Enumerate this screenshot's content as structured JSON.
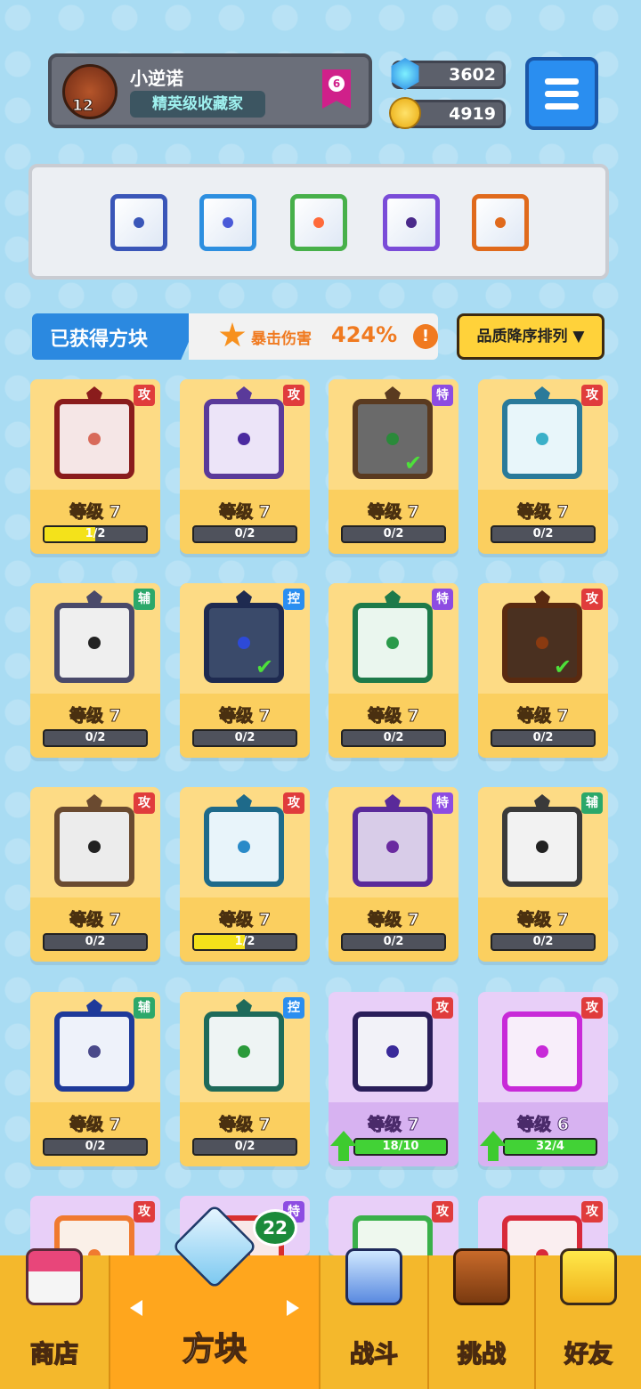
{
  "profile": {
    "name": "小逆诺",
    "title": "精英级收藏家",
    "level": "12",
    "rank_badge": "6"
  },
  "resources": {
    "gems": "3602",
    "coins": "4919"
  },
  "equipped": [
    {
      "icon": "gear-dice",
      "color": "#3a56b8",
      "dot": "#3a56b8"
    },
    {
      "icon": "snowflake-dice",
      "color": "#2d8fe0",
      "dot": "#4a5ad8"
    },
    {
      "icon": "infinity-dice",
      "color": "#47b04a",
      "dot": "#ff6a3a"
    },
    {
      "icon": "lightning-dice",
      "color": "#7a4cd8",
      "dot": "#4a2a8a"
    },
    {
      "icon": "flame-dice",
      "color": "#e06a1c",
      "dot": "#e06a1c"
    }
  ],
  "collection_bar": {
    "label": "已获得方块",
    "crit_label": "暴击伤害",
    "crit_value": "424%",
    "info": "!"
  },
  "sort_button": "品质降序排列 ▼",
  "cards": [
    {
      "tag": "攻",
      "tag_type": "atk",
      "level": "等级 7",
      "progress": "1/2",
      "fill": 0.5,
      "frame": "#8a1c1c",
      "inner": "#f5e6e6",
      "core": "#d86a5a",
      "icon": "compass-star-icon",
      "style": "top"
    },
    {
      "tag": "攻",
      "tag_type": "atk",
      "level": "等级 7",
      "progress": "0/2",
      "fill": 0,
      "frame": "#5a3a9a",
      "inner": "#ece4f8",
      "core": "#4b2aa0",
      "icon": "magic-circle-icon",
      "style": "top"
    },
    {
      "tag": "特",
      "tag_type": "spe",
      "level": "等级 7",
      "progress": "0/2",
      "fill": 0,
      "frame": "#5a3a20",
      "inner": "#6a6a6a",
      "core": "#2a8a3a",
      "icon": "infinity-icon",
      "style": "top",
      "check": true
    },
    {
      "tag": "攻",
      "tag_type": "atk",
      "level": "等级 7",
      "progress": "0/2",
      "fill": 0,
      "frame": "#2a7a9a",
      "inner": "#e8f6fa",
      "core": "#3ab0c8",
      "icon": "totem-icon",
      "style": "top"
    },
    {
      "tag": "辅",
      "tag_type": "sup",
      "level": "等级 7",
      "progress": "0/2",
      "fill": 0,
      "frame": "#4a4a6a",
      "inner": "#efefef",
      "core": "#222222",
      "icon": "jaws-icon",
      "style": "top"
    },
    {
      "tag": "控",
      "tag_type": "ctl",
      "level": "等级 7",
      "progress": "0/2",
      "fill": 0,
      "frame": "#1e2a50",
      "inner": "#3a4a6a",
      "core": "#2d4ad8",
      "icon": "snowflake-icon",
      "style": "top",
      "check": true
    },
    {
      "tag": "特",
      "tag_type": "spe",
      "level": "等级 7",
      "progress": "0/2",
      "fill": 0,
      "frame": "#1e7a4a",
      "inner": "#eaf6ee",
      "core": "#2a9a4a",
      "icon": "pentagram-icon",
      "style": "top"
    },
    {
      "tag": "攻",
      "tag_type": "atk",
      "level": "等级 7",
      "progress": "0/2",
      "fill": 0,
      "frame": "#5a2a10",
      "inner": "#4a3020",
      "core": "#8a3a10",
      "icon": "flame-swirl-icon",
      "style": "top",
      "check": true
    },
    {
      "tag": "攻",
      "tag_type": "atk",
      "level": "等级 7",
      "progress": "0/2",
      "fill": 0,
      "frame": "#6a4a30",
      "inner": "#ececec",
      "core": "#222222",
      "icon": "pistol-icon",
      "style": "top"
    },
    {
      "tag": "攻",
      "tag_type": "atk",
      "level": "等级 7",
      "progress": "1/2",
      "fill": 0.5,
      "frame": "#1e6a8a",
      "inner": "#e8f4fa",
      "core": "#2a8ac8",
      "icon": "vortex-icon",
      "style": "top"
    },
    {
      "tag": "特",
      "tag_type": "spe",
      "level": "等级 7",
      "progress": "0/2",
      "fill": 0,
      "frame": "#5a2a9a",
      "inner": "#d8cce8",
      "core": "#6a2aa0",
      "icon": "shadow-icon",
      "style": "top"
    },
    {
      "tag": "辅",
      "tag_type": "sup",
      "level": "等级 7",
      "progress": "0/2",
      "fill": 0,
      "frame": "#3a3a3a",
      "inner": "#f2f2f2",
      "core": "#222222",
      "icon": "clock-ring-icon",
      "style": "top"
    },
    {
      "tag": "辅",
      "tag_type": "sup",
      "level": "等级 7",
      "progress": "0/2",
      "fill": 0,
      "frame": "#1e3a9a",
      "inner": "#eef2fa",
      "core": "#4a4a8a",
      "icon": "crescent-moon-icon",
      "style": "top"
    },
    {
      "tag": "控",
      "tag_type": "ctl",
      "level": "等级 7",
      "progress": "0/2",
      "fill": 0,
      "frame": "#1e6a5a",
      "inner": "#eef4f4",
      "core": "#2a9a3a",
      "icon": "wind-icon",
      "style": "top"
    },
    {
      "tag": "攻",
      "tag_type": "atk",
      "level": "等级 7",
      "progress": "18/10",
      "fill": 1,
      "frame": "#2a1e5a",
      "inner": "#f2f2f8",
      "core": "#3a2a9a",
      "icon": "scythe-icon",
      "style": "purple",
      "upgrade": true
    },
    {
      "tag": "攻",
      "tag_type": "atk",
      "level": "等级 6",
      "progress": "32/4",
      "fill": 1,
      "frame": "#c82ad8",
      "inner": "#f8eefa",
      "core": "#c82ad8",
      "icon": "pixel-dot-icon",
      "style": "purple",
      "upgrade": true
    },
    {
      "tag": "攻",
      "tag_type": "atk",
      "level": "",
      "progress": "",
      "fill": 0,
      "frame": "#f07a30",
      "inner": "#faf0e8",
      "core": "#f07a30",
      "icon": "target-icon",
      "style": "purple",
      "partial": true
    },
    {
      "tag": "特",
      "tag_type": "spe",
      "level": "",
      "progress": "",
      "fill": 0,
      "frame": "#d83030",
      "inner": "#f8e8e8",
      "core": "#d83030",
      "icon": "mystery-icon",
      "style": "purple",
      "partial": true
    },
    {
      "tag": "攻",
      "tag_type": "atk",
      "level": "",
      "progress": "",
      "fill": 0,
      "frame": "#3ab04a",
      "inner": "#eef8ee",
      "core": "#3ab04a",
      "icon": "wifi-icon",
      "style": "purple",
      "partial": true
    },
    {
      "tag": "攻",
      "tag_type": "atk",
      "level": "",
      "progress": "",
      "fill": 0,
      "frame": "#d82a3a",
      "inner": "#faeef0",
      "core": "#d82a3a",
      "icon": "crack-icon",
      "style": "purple",
      "partial": true
    }
  ],
  "nav": {
    "shop": "商店",
    "dice": "方块",
    "battle": "战斗",
    "challenge": "挑战",
    "friends": "好友",
    "dice_count": "22",
    "prev": "◀",
    "next": "▶"
  }
}
